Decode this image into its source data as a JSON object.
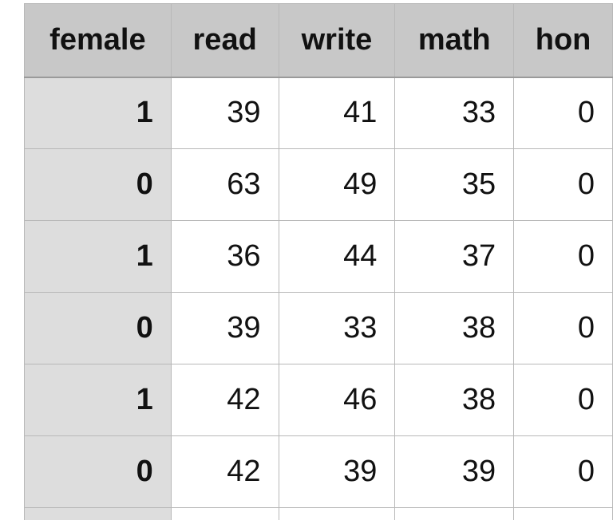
{
  "columns": [
    "female",
    "read",
    "write",
    "math",
    "hon"
  ],
  "rows": [
    [
      "1",
      "39",
      "41",
      "33",
      "0"
    ],
    [
      "0",
      "63",
      "49",
      "35",
      "0"
    ],
    [
      "1",
      "36",
      "44",
      "37",
      "0"
    ],
    [
      "0",
      "39",
      "33",
      "38",
      "0"
    ],
    [
      "1",
      "42",
      "46",
      "38",
      "0"
    ],
    [
      "0",
      "42",
      "39",
      "39",
      "0"
    ]
  ]
}
